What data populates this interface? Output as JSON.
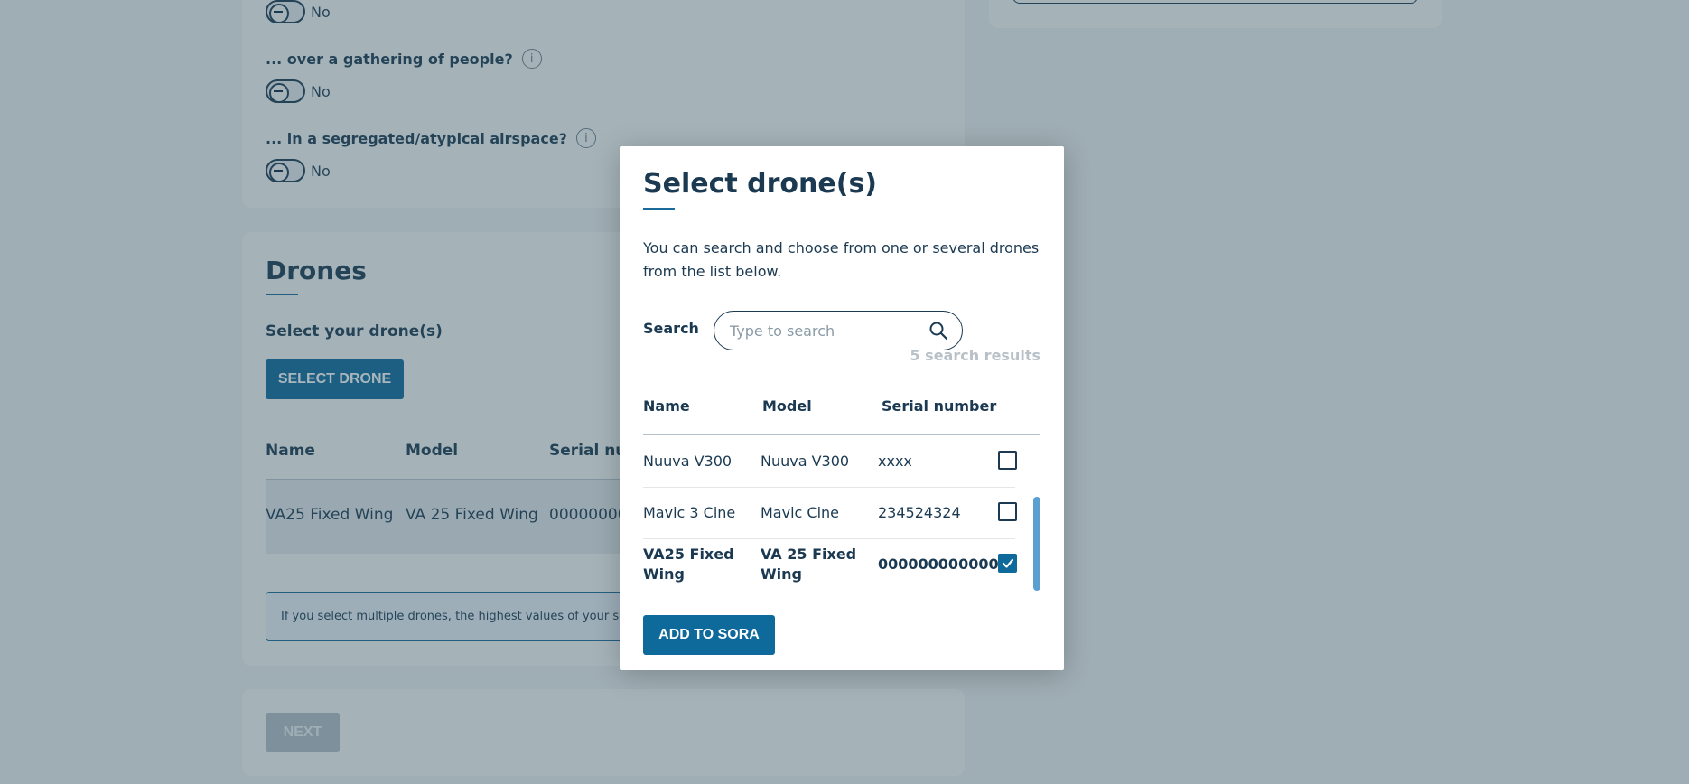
{
  "questions": [
    {
      "label": "",
      "toggle_value": "No"
    },
    {
      "label": "... over a gathering of people?",
      "toggle_value": "No"
    },
    {
      "label": "... in a segregated/atypical airspace?",
      "toggle_value": "No"
    }
  ],
  "drones_section": {
    "title": "Drones",
    "subtitle": "Select your drone(s)",
    "select_button": "SELECT DRONE",
    "columns": [
      "Name",
      "Model",
      "Serial num"
    ],
    "row": {
      "name": "VA25 Fixed Wing",
      "model": "VA 25 Fixed Wing",
      "serial": "000000000"
    },
    "info_text": "If you select multiple drones, the highest values of your selecte"
  },
  "next_button": "NEXT",
  "modal": {
    "title": "Select drone(s)",
    "description": "You can search and choose from one or several drones from the list below.",
    "search_label": "Search",
    "search_placeholder": "Type to search",
    "search_value": "",
    "results_count": "5 search results",
    "columns": {
      "name": "Name",
      "model": "Model",
      "serial": "Serial number"
    },
    "rows": [
      {
        "name": "Nuuva V300",
        "model": "Nuuva V300",
        "serial": "xxxx",
        "checked": false
      },
      {
        "name": "Mavic 3 Cine",
        "model": "Mavic Cine",
        "serial": "234524324",
        "checked": false
      },
      {
        "name": "VA25 Fixed Wing",
        "model": "VA 25 Fixed Wing",
        "serial": "000000000000",
        "checked": true
      }
    ],
    "add_button": "ADD TO SORA"
  },
  "colors": {
    "primary": "#0e6a9b",
    "text": "#1b3a52",
    "overlay": "rgba(50,80,96,0.42)",
    "scrollbar": "#5a9fd0"
  },
  "icons": [
    "info-icon",
    "search-icon",
    "checkbox-checked-icon",
    "toggle-icon"
  ]
}
